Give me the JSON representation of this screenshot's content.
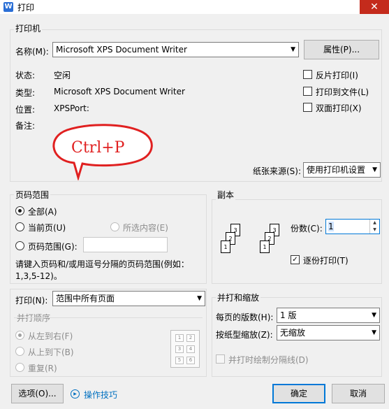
{
  "window": {
    "title": "打印",
    "app_icon": "W",
    "close_glyph": "✕"
  },
  "printer": {
    "group_label": "打印机",
    "name_label": "名称(M):",
    "name_value": "Microsoft XPS Document Writer",
    "properties_button": "属性(P)...",
    "status_label": "状态:",
    "status_value": "空闲",
    "type_label": "类型:",
    "type_value": "Microsoft XPS Document Writer",
    "location_label": "位置:",
    "location_value": "XPSPort:",
    "comment_label": "备注:",
    "reverse_print": "反片打印(I)",
    "print_to_file": "打印到文件(L)",
    "duplex_print": "双面打印(X)",
    "paper_source_label": "纸张来源(S):",
    "paper_source_value": "使用打印机设置",
    "annotation": "Ctrl+P"
  },
  "page_range": {
    "group_label": "页码范围",
    "all": "全部(A)",
    "current": "当前页(U)",
    "selection": "所选内容(E)",
    "pages": "页码范围(G):",
    "pages_value": "",
    "hint": "请键入页码和/或用逗号分隔的页码范围(例如：1,3,5-12)。"
  },
  "copies": {
    "group_label": "副本",
    "count_label": "份数(C):",
    "count_value": "1",
    "collate": "逐份打印(T)",
    "collate_checked": true
  },
  "print_what": {
    "label": "打印(N):",
    "value": "范围中所有页面",
    "order_label": "并打顺序",
    "left_to_right": "从左到右(F)",
    "top_to_bottom": "从上到下(B)",
    "repeat": "重复(R)"
  },
  "zoom": {
    "group_label": "并打和缩放",
    "pages_per_sheet_label": "每页的版数(H):",
    "pages_per_sheet_value": "1 版",
    "scale_label": "按纸型缩放(Z):",
    "scale_value": "无缩放",
    "draw_lines": "并打时绘制分隔线(D)"
  },
  "footer": {
    "options_button": "选项(O)...",
    "tips_link": "操作技巧",
    "ok_button": "确定",
    "cancel_button": "取消"
  },
  "colors": {
    "accent": "#0078d7",
    "annotation_red": "#e02020",
    "close_red": "#c42b1c"
  },
  "icons": [
    "app-icon",
    "close-icon",
    "dropdown-arrow-icon",
    "collate-pages-icon",
    "pages-order-grid-icon",
    "tips-icon"
  ]
}
